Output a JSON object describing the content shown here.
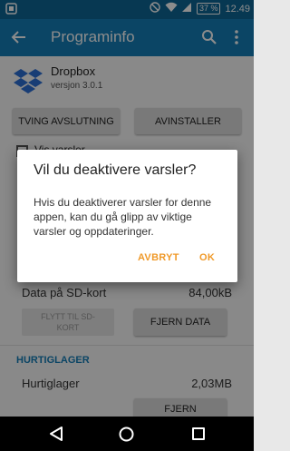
{
  "status_bar": {
    "battery": "37 %",
    "time": "12.49"
  },
  "app_bar": {
    "title": "Programinfo"
  },
  "app": {
    "name": "Dropbox",
    "version": "versjon 3.0.1"
  },
  "buttons": {
    "force_stop": "TVING AVSLUTNING",
    "uninstall": "AVINSTALLER",
    "move_to_sd": "FLYTT TIL SD-KORT",
    "clear_data": "FJERN DATA",
    "clear_cache": "FJERN"
  },
  "notifications_checkbox_label": "Vis varsler",
  "storage": {
    "sd_label": "Data på SD-kort",
    "sd_value": "84,00kB"
  },
  "cache": {
    "section_title": "HURTIGLAGER",
    "label": "Hurtiglager",
    "value": "2,03MB"
  },
  "dialog": {
    "title": "Vil du deaktivere varsler?",
    "message": "Hvis du deaktiverer varsler for denne appen, kan du gå glipp av viktige varsler og oppdateringer.",
    "cancel": "AVBRYT",
    "ok": "OK"
  },
  "colors": {
    "status_bar": "#0e6796",
    "app_bar": "#147eb8",
    "accent": "#f09a2a"
  }
}
